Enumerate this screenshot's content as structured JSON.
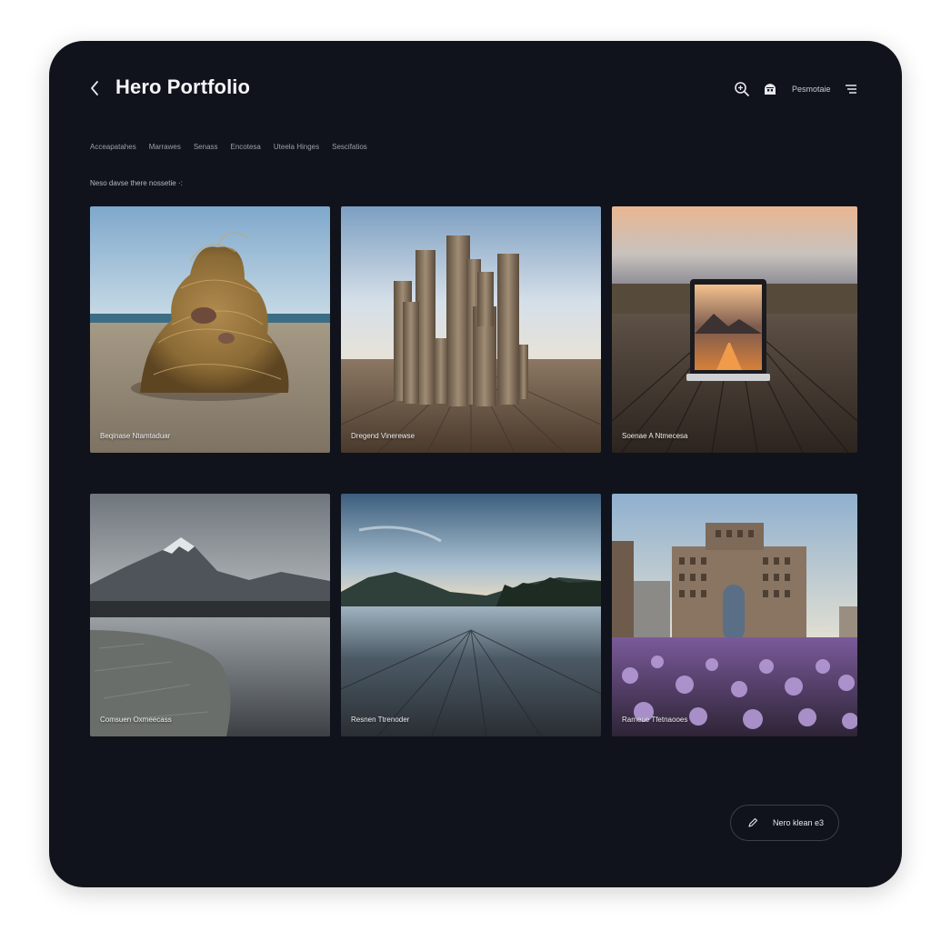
{
  "header": {
    "title": "Hero Portfolio",
    "right_label": "Pesmotaie",
    "icons": [
      "back-chevron-icon",
      "search-zoom-icon",
      "home-icon",
      "menu-icon"
    ]
  },
  "filters": [
    "Acceapatahes",
    "Marrawes",
    "Senass",
    "Encotesa",
    "Uteela  Hinges",
    "Sescifatios"
  ],
  "section_label": "Neso davse there nossetie ·:",
  "gallery": [
    {
      "caption": "Beqinase Ntamtaduar"
    },
    {
      "caption": "Dregend Vinerewse"
    },
    {
      "caption": "Soenae A Ntmecesa"
    },
    {
      "caption": "Comsuen Oxmeecass"
    },
    {
      "caption": "Resnen Ttrenoder"
    },
    {
      "caption": "Rameue Tfetnaooes"
    }
  ],
  "fab": {
    "label": "Nero klean  e3",
    "icon": "pen-icon"
  },
  "colors": {
    "background": "#10131b",
    "text": "#f4f5f7",
    "muted": "#9aa0aa"
  }
}
